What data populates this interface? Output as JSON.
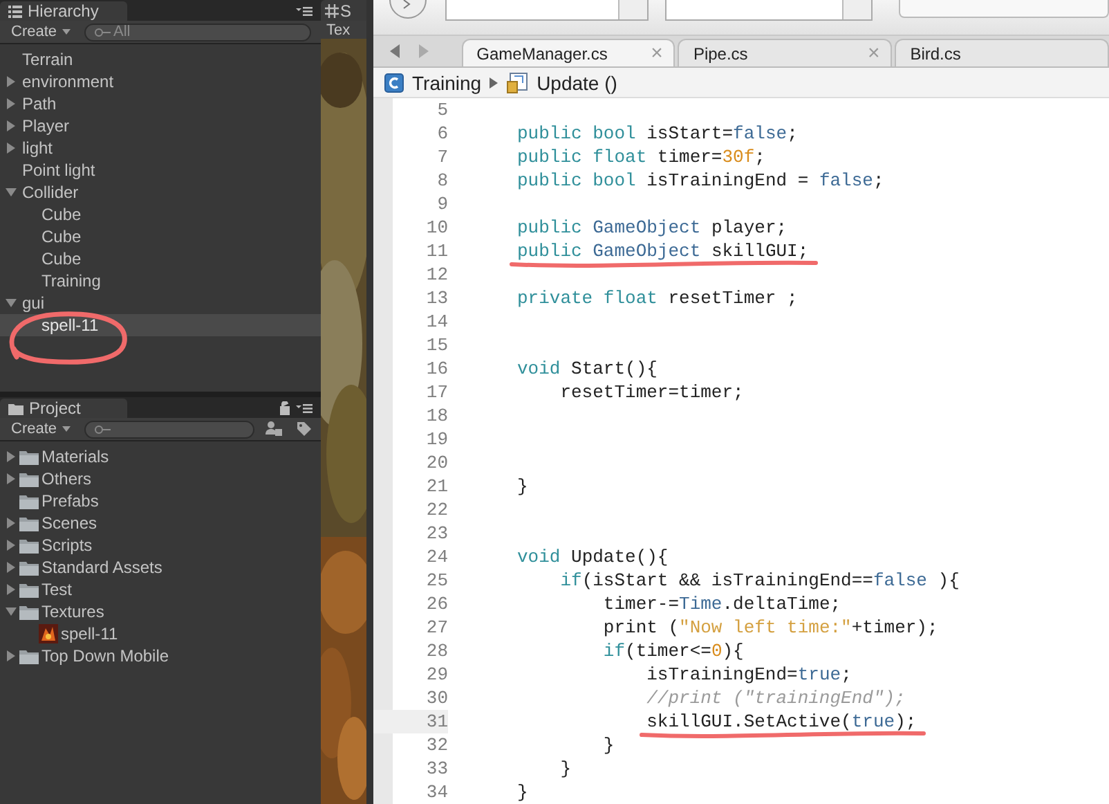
{
  "hierarchy": {
    "title": "Hierarchy",
    "create_button": "Create",
    "search": {
      "placeholder": "All"
    },
    "items": [
      {
        "label": "Terrain",
        "selected": false
      },
      {
        "label": "environment",
        "expanded": false,
        "selected": false
      },
      {
        "label": "Path",
        "expanded": false,
        "selected": false
      },
      {
        "label": "Player",
        "expanded": false,
        "selected": false
      },
      {
        "label": "light",
        "expanded": false,
        "selected": false
      },
      {
        "label": "Point light",
        "selected": false
      },
      {
        "label": "Collider",
        "expanded": true,
        "selected": false,
        "children": [
          {
            "label": "Cube",
            "selected": false
          },
          {
            "label": "Cube",
            "selected": false
          },
          {
            "label": "Cube",
            "selected": false
          },
          {
            "label": "Training",
            "selected": false
          }
        ]
      },
      {
        "label": "gui",
        "expanded": true,
        "selected": false,
        "children": [
          {
            "label": "spell-11",
            "selected": true,
            "circled": true
          }
        ]
      }
    ]
  },
  "scene_view": {
    "tab_label": "S",
    "toolbar_label": "Tex"
  },
  "project": {
    "title": "Project",
    "create_button": "Create",
    "items": [
      {
        "label": "Materials",
        "kind": "folder",
        "expanded": false
      },
      {
        "label": "Others",
        "kind": "folder",
        "expanded": false
      },
      {
        "label": "Prefabs",
        "kind": "folder"
      },
      {
        "label": "Scenes",
        "kind": "folder",
        "expanded": false
      },
      {
        "label": "Scripts",
        "kind": "folder",
        "expanded": false
      },
      {
        "label": "Standard Assets",
        "kind": "folder",
        "expanded": false
      },
      {
        "label": "Test",
        "kind": "folder",
        "expanded": false
      },
      {
        "label": "Textures",
        "kind": "folder",
        "expanded": true,
        "children": [
          {
            "label": "spell-11",
            "kind": "texture"
          }
        ]
      },
      {
        "label": "Top Down Mobile",
        "kind": "folder",
        "expanded": false
      }
    ]
  },
  "editor": {
    "tabs": [
      {
        "label": "GameManager.cs",
        "close": "×",
        "selected": true
      },
      {
        "label": "Pipe.cs",
        "close": "×",
        "selected": false
      },
      {
        "label": "Bird.cs",
        "selected": false
      }
    ],
    "breadcrumb": {
      "class_name": "Training",
      "method": "Update ()"
    },
    "lines": [
      {
        "number": "5"
      },
      {
        "number": "6",
        "tokens": [
          {
            "kind": "keyword",
            "text": "public"
          },
          {
            "kind": "keyword",
            "text": " bool"
          },
          {
            "kind": "plain",
            "text": " isStart="
          },
          {
            "kind": "literal",
            "text": "false"
          },
          {
            "kind": "plain",
            "text": ";"
          }
        ]
      },
      {
        "number": "7",
        "tokens": [
          {
            "kind": "keyword",
            "text": "public"
          },
          {
            "kind": "keyword",
            "text": " float"
          },
          {
            "kind": "plain",
            "text": " timer="
          },
          {
            "kind": "number",
            "text": "30f"
          },
          {
            "kind": "plain",
            "text": ";"
          }
        ]
      },
      {
        "number": "8",
        "tokens": [
          {
            "kind": "keyword",
            "text": "public"
          },
          {
            "kind": "keyword",
            "text": " bool"
          },
          {
            "kind": "plain",
            "text": " isTrainingEnd = "
          },
          {
            "kind": "literal",
            "text": "false"
          },
          {
            "kind": "plain",
            "text": ";"
          }
        ]
      },
      {
        "number": "9"
      },
      {
        "number": "10",
        "tokens": [
          {
            "kind": "keyword",
            "text": "public"
          },
          {
            "kind": "type",
            "text": " GameObject"
          },
          {
            "kind": "plain",
            "text": " player;"
          }
        ]
      },
      {
        "number": "11",
        "underlined": true,
        "tokens": [
          {
            "kind": "keyword",
            "text": "public"
          },
          {
            "kind": "type",
            "text": " GameObject"
          },
          {
            "kind": "plain",
            "text": " skillGUI;"
          }
        ]
      },
      {
        "number": "12"
      },
      {
        "number": "13",
        "tokens": [
          {
            "kind": "keyword",
            "text": "private"
          },
          {
            "kind": "keyword",
            "text": " float"
          },
          {
            "kind": "plain",
            "text": " resetTimer ;"
          }
        ]
      },
      {
        "number": "14"
      },
      {
        "number": "15"
      },
      {
        "number": "16",
        "tokens": [
          {
            "kind": "keyword",
            "text": "void"
          },
          {
            "kind": "plain",
            "text": " Start(){"
          }
        ]
      },
      {
        "number": "17",
        "tokens": [
          {
            "kind": "plain",
            "text": "    resetTimer=timer;"
          }
        ]
      },
      {
        "number": "18"
      },
      {
        "number": "19"
      },
      {
        "number": "20"
      },
      {
        "number": "21",
        "tokens": [
          {
            "kind": "plain",
            "text": "}"
          }
        ]
      },
      {
        "number": "22"
      },
      {
        "number": "23"
      },
      {
        "number": "24",
        "tokens": [
          {
            "kind": "keyword",
            "text": "void"
          },
          {
            "kind": "plain",
            "text": " Update(){"
          }
        ]
      },
      {
        "number": "25",
        "tokens": [
          {
            "kind": "keyword",
            "text": "    if"
          },
          {
            "kind": "plain",
            "text": "(isStart && isTrainingEnd=="
          },
          {
            "kind": "literal",
            "text": "false"
          },
          {
            "kind": "plain",
            "text": " ){"
          }
        ]
      },
      {
        "number": "26",
        "tokens": [
          {
            "kind": "plain",
            "text": "        timer-="
          },
          {
            "kind": "type",
            "text": "Time"
          },
          {
            "kind": "plain",
            "text": ".deltaTime;"
          }
        ]
      },
      {
        "number": "27",
        "tokens": [
          {
            "kind": "plain",
            "text": "        print ("
          },
          {
            "kind": "string",
            "text": "\"Now left time:\""
          },
          {
            "kind": "plain",
            "text": "+timer);"
          }
        ]
      },
      {
        "number": "28",
        "tokens": [
          {
            "kind": "keyword",
            "text": "        if"
          },
          {
            "kind": "plain",
            "text": "(timer<="
          },
          {
            "kind": "number",
            "text": "0"
          },
          {
            "kind": "plain",
            "text": "){"
          }
        ]
      },
      {
        "number": "29",
        "tokens": [
          {
            "kind": "plain",
            "text": "            isTrainingEnd="
          },
          {
            "kind": "literal",
            "text": "true"
          },
          {
            "kind": "plain",
            "text": ";"
          }
        ]
      },
      {
        "number": "30",
        "tokens": [
          {
            "kind": "comment",
            "text": "            //print (\"trainingEnd\");"
          }
        ]
      },
      {
        "number": "31",
        "current": true,
        "underlined": true,
        "tokens": [
          {
            "kind": "plain",
            "text": "            skillGUI.SetActive("
          },
          {
            "kind": "literal",
            "text": "true"
          },
          {
            "kind": "plain",
            "text": ");"
          }
        ]
      },
      {
        "number": "32",
        "tokens": [
          {
            "kind": "plain",
            "text": "        }"
          }
        ]
      },
      {
        "number": "33",
        "tokens": [
          {
            "kind": "plain",
            "text": "    }"
          }
        ]
      },
      {
        "number": "34",
        "tokens": [
          {
            "kind": "plain",
            "text": "}"
          }
        ]
      }
    ]
  }
}
